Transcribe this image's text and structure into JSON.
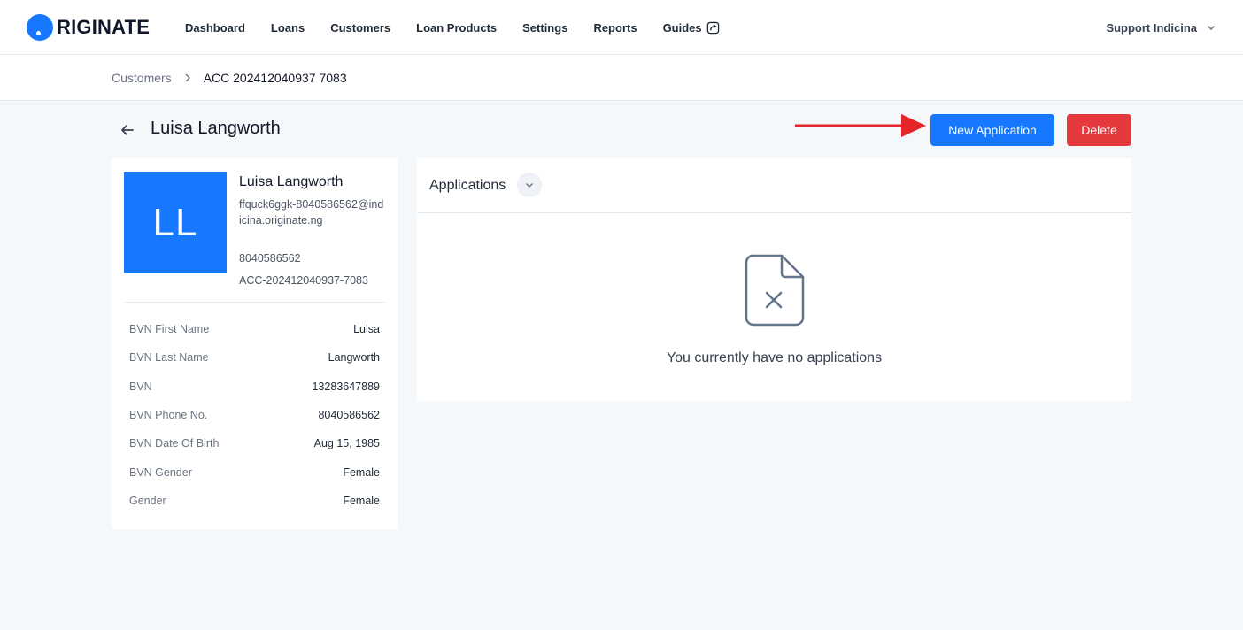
{
  "brand": {
    "logo_text": "RIGINATE",
    "accent": "#1677ff"
  },
  "nav": {
    "items": [
      {
        "label": "Dashboard"
      },
      {
        "label": "Loans"
      },
      {
        "label": "Customers"
      },
      {
        "label": "Loan Products"
      },
      {
        "label": "Settings"
      },
      {
        "label": "Reports"
      },
      {
        "label": "Guides",
        "icon": "external-link-icon"
      }
    ],
    "user_label": "Support Indicina"
  },
  "breadcrumb": {
    "parent": "Customers",
    "current": "ACC 202412040937 7083"
  },
  "page": {
    "title": "Luisa Langworth",
    "new_application_label": "New Application",
    "delete_label": "Delete",
    "delete_color": "#e5393e"
  },
  "customer": {
    "initials": "LL",
    "name": "Luisa Langworth",
    "email": "ffquck6ggk-8040586562@indicina.originate.ng",
    "phone": "8040586562",
    "account": "ACC-202412040937-7083",
    "details": [
      {
        "label": "BVN First Name",
        "value": "Luisa"
      },
      {
        "label": "BVN Last Name",
        "value": "Langworth"
      },
      {
        "label": "BVN",
        "value": "13283647889"
      },
      {
        "label": "BVN Phone No.",
        "value": "8040586562"
      },
      {
        "label": "BVN Date Of Birth",
        "value": "Aug 15, 1985"
      },
      {
        "label": "BVN Gender",
        "value": "Female"
      },
      {
        "label": "Gender",
        "value": "Female"
      }
    ]
  },
  "applications": {
    "title": "Applications",
    "empty_message": "You currently have no applications"
  }
}
